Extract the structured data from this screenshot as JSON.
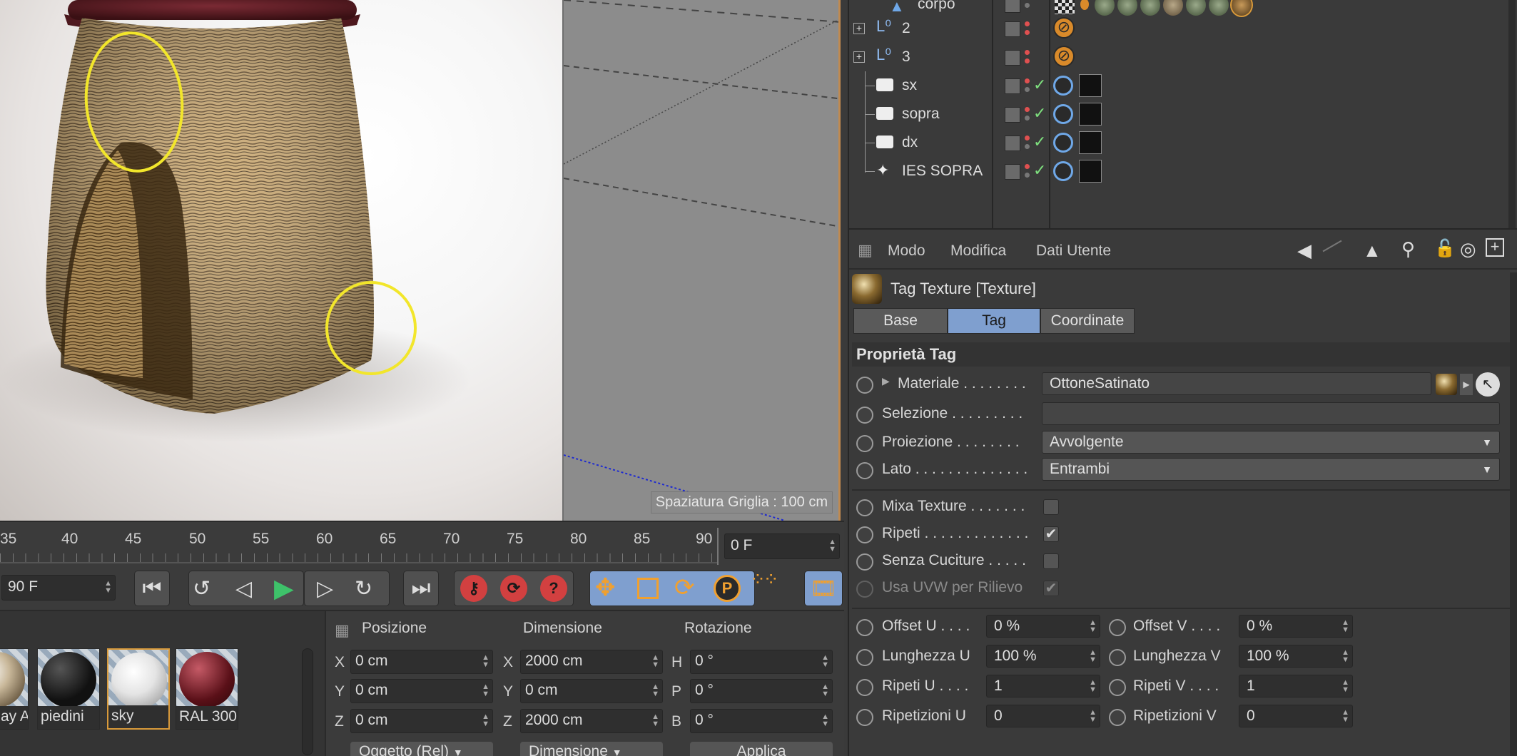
{
  "render": {
    "bottom_text": ""
  },
  "viewport": {
    "grid_spacing": "Spaziatura Griglia : 100 cm"
  },
  "timeline": {
    "ticks": [
      "35",
      "40",
      "45",
      "50",
      "55",
      "60",
      "65",
      "70",
      "75",
      "80",
      "85",
      "90"
    ],
    "current_frame": "0 F",
    "end_frame": "90 F"
  },
  "materials": [
    {
      "name": "ay A"
    },
    {
      "name": "piedini"
    },
    {
      "name": "sky"
    },
    {
      "name": "RAL 300"
    }
  ],
  "coords": {
    "headers": {
      "position": "Posizione",
      "size": "Dimensione",
      "rotation": "Rotazione"
    },
    "position": {
      "x": "0 cm",
      "y": "0 cm",
      "z": "0 cm"
    },
    "size": {
      "x": "2000 cm",
      "y": "0 cm",
      "z": "2000 cm"
    },
    "rotation": {
      "h": "0 °",
      "p": "0 °",
      "b": "0 °"
    },
    "axis_labels": {
      "x": "X",
      "y": "Y",
      "z": "Z",
      "h": "H",
      "p": "P",
      "b": "B"
    },
    "mode_dropdown": "Oggetto (Rel)",
    "size_dropdown": "Dimensione",
    "apply_button": "Applica"
  },
  "objects": [
    {
      "name": "corpo"
    },
    {
      "name": "2"
    },
    {
      "name": "3"
    },
    {
      "name": "sx"
    },
    {
      "name": "sopra"
    },
    {
      "name": "dx"
    },
    {
      "name": "IES SOPRA"
    }
  ],
  "attributes": {
    "menu": [
      "Modo",
      "Modifica",
      "Dati Utente"
    ],
    "title": "Tag Texture [Texture]",
    "tabs": [
      "Base",
      "Tag",
      "Coordinate"
    ],
    "section": "Proprietà Tag",
    "materiale_label": "Materiale . . . . . . . .",
    "materiale_value": "OttoneSatinato",
    "selezione_label": "Selezione . . . . . . . . .",
    "proiezione_label": "Proiezione . . . . . . . .",
    "proiezione_value": "Avvolgente",
    "lato_label": "Lato . . . . . . . . . . . . . .",
    "lato_value": "Entrambi",
    "mixa_label": "Mixa Texture . . . . . . .",
    "ripeti_label": "Ripeti . . . . . . . . . . . . .",
    "cuciture_label": "Senza Cuciture . . . . .",
    "uvw_label": "Usa UVW per Rilievo",
    "offset_u_label": "Offset U . . . .",
    "offset_u": "0 %",
    "offset_v_label": "Offset V . . . .",
    "offset_v": "0 %",
    "lung_u_label": "Lunghezza U",
    "lung_u": "100 %",
    "lung_v_label": "Lunghezza V",
    "lung_v": "100 %",
    "rip_u_label": "Ripeti U . . . .",
    "rip_u": "1",
    "rip_v_label": "Ripeti V . . . .",
    "rip_v": "1",
    "ripz_u_label": "Ripetizioni U",
    "ripz_u": "0",
    "ripz_v_label": "Ripetizioni V",
    "ripz_v": "0"
  }
}
